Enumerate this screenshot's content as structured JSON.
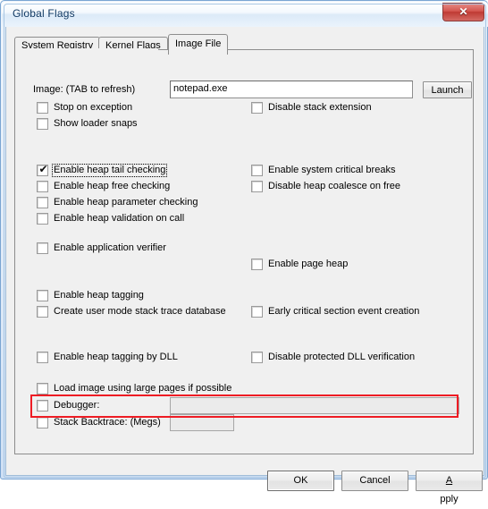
{
  "window": {
    "title": "Global Flags",
    "close_label": "✕",
    "close_icon": "close-icon"
  },
  "tabs": [
    {
      "label": "System Registry",
      "active": false
    },
    {
      "label": "Kernel Flags",
      "active": false
    },
    {
      "label": "Image File",
      "active": true
    }
  ],
  "image_section": {
    "label": "Image: (TAB to refresh)",
    "input_value": "notepad.exe",
    "input_placeholder": "",
    "launch_label": "Launch"
  },
  "checkboxes": {
    "stop_on_exception": {
      "label": "Stop on exception",
      "checked": false
    },
    "show_loader_snaps": {
      "label": "Show loader snaps",
      "checked": false
    },
    "disable_stack_extension": {
      "label": "Disable stack extension",
      "checked": false
    },
    "enable_heap_tail_checking": {
      "label": "Enable heap tail checking",
      "checked": true,
      "focused": true
    },
    "enable_heap_free_checking": {
      "label": "Enable heap free checking",
      "checked": false
    },
    "enable_heap_parameter_checking": {
      "label": "Enable heap parameter checking",
      "checked": false
    },
    "enable_heap_validation_on_call": {
      "label": "Enable heap validation on call",
      "checked": false
    },
    "enable_system_critical_breaks": {
      "label": "Enable system critical breaks",
      "checked": false
    },
    "disable_heap_coalesce_on_free": {
      "label": "Disable heap coalesce on free",
      "checked": false
    },
    "enable_application_verifier": {
      "label": "Enable application verifier",
      "checked": false
    },
    "enable_page_heap": {
      "label": "Enable page heap",
      "checked": false
    },
    "enable_heap_tagging": {
      "label": "Enable heap tagging",
      "checked": false
    },
    "create_user_mode_stack_trace_database": {
      "label": "Create user mode stack trace database",
      "checked": false
    },
    "early_critical_section_event_creation": {
      "label": "Early critical section event creation",
      "checked": false
    },
    "enable_heap_tagging_by_dll": {
      "label": "Enable heap tagging by DLL",
      "checked": false
    },
    "disable_protected_dll_verification": {
      "label": "Disable protected DLL verification",
      "checked": false
    },
    "load_image_using_large_pages": {
      "label": "Load image using large pages if possible",
      "checked": false
    },
    "debugger": {
      "label": "Debugger:",
      "checked": false
    },
    "stack_backtrace": {
      "label": "Stack Backtrace: (Megs)",
      "checked": false
    }
  },
  "fields": {
    "debugger_value": "",
    "stack_backtrace_value": ""
  },
  "buttons": {
    "ok": "OK",
    "cancel": "Cancel",
    "apply_prefix": "A",
    "apply_rest": "pply"
  },
  "check_glyph": "✔",
  "colors": {
    "highlight": "#ee1c24",
    "dialog_face": "#f0f0f0",
    "title_text": "#123a63",
    "close_button": "#bf3a33"
  }
}
